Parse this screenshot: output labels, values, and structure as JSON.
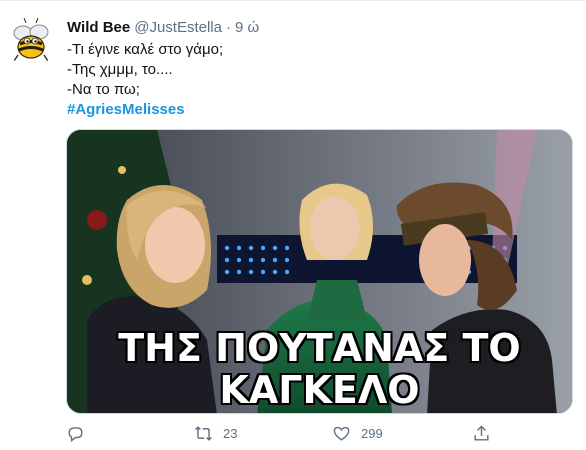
{
  "tweet": {
    "author_name": "Wild Bee",
    "handle": "@JustEstella",
    "separator": "·",
    "time": "9 ώ",
    "lines": [
      "-Τι έγινε καλέ στο γάμο;",
      "-Της χμμμ, το....",
      "-Να το πω;"
    ],
    "hashtag": "#AgriesMelisses"
  },
  "media": {
    "caption_line1": "ΤΗΣ ΠΟΥΤΑΝΑΣ ΤΟ",
    "caption_line2": "ΚΑΓΚΕΛΟ"
  },
  "actions": {
    "reply_icon": "reply-icon",
    "retweet_icon": "retweet-icon",
    "retweet_count": "23",
    "like_icon": "heart-icon",
    "like_count": "299",
    "share_icon": "share-icon"
  },
  "colors": {
    "link": "#1b95e0",
    "secondary_text": "#5b7083",
    "primary_text": "#0f1419"
  }
}
